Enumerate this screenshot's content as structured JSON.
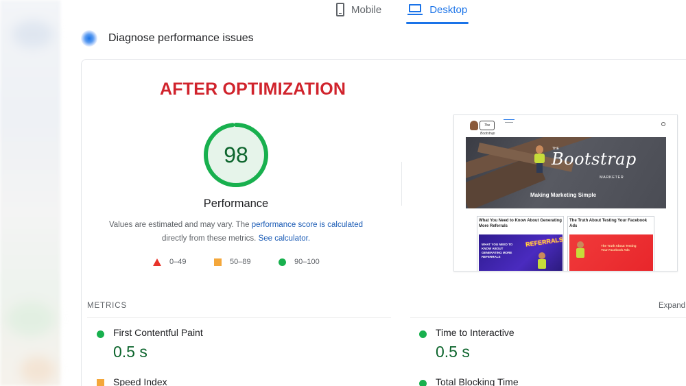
{
  "tabs": [
    {
      "label": "Mobile",
      "icon": "mobile-phone-icon",
      "active": false
    },
    {
      "label": "Desktop",
      "icon": "laptop-icon",
      "active": true
    }
  ],
  "diagnose": {
    "title": "Diagnose performance issues",
    "icon": "sparkle-icon"
  },
  "overlay_title": "AFTER OPTIMIZATION",
  "score": {
    "value": "98",
    "fraction": 0.98,
    "label": "Performance",
    "color": "#18b04e"
  },
  "description": {
    "text1": "Values are estimated and may vary. The ",
    "link1": "performance score is calculated",
    "text2": "directly from these metrics. ",
    "link2": "See calculator."
  },
  "legend": [
    {
      "range": "0–49",
      "shape": "triangle",
      "color": "#e8332a"
    },
    {
      "range": "50–89",
      "shape": "square",
      "color": "#f4a73b"
    },
    {
      "range": "90–100",
      "shape": "circle",
      "color": "#18b04e"
    }
  ],
  "thumbnail": {
    "logo_text": "The Bootstrap",
    "hero_the": "THE",
    "hero_title": "Bootstrap",
    "hero_marketer": "MARKETER",
    "hero_subtitle": "Making Marketing Simple",
    "cards": [
      {
        "title": "What You Need to Know About Generating More Referrals",
        "image_text": "WHAT YOU NEED TO KNOW ABOUT GENERATING MORE REFERRALS",
        "badge": "REFERRALS"
      },
      {
        "title": "The Truth About Testing Your Facebook Ads",
        "image_text": "The Truth About Testing Your Facebook Ads"
      }
    ]
  },
  "metrics": {
    "label": "METRICS",
    "expand_label": "Expand",
    "items": [
      {
        "name": "First Contentful Paint",
        "value": "0.5 s",
        "status": "good"
      },
      {
        "name": "Time to Interactive",
        "value": "0.5 s",
        "status": "good"
      },
      {
        "name": "Speed Index",
        "value": "",
        "status": "average"
      },
      {
        "name": "Total Blocking Time",
        "value": "",
        "status": "good"
      }
    ]
  },
  "colors": {
    "accent": "#1a73e8",
    "good": "#18b04e",
    "average": "#f4a73b",
    "poor": "#e8332a",
    "overlay_red": "#d0232c"
  }
}
